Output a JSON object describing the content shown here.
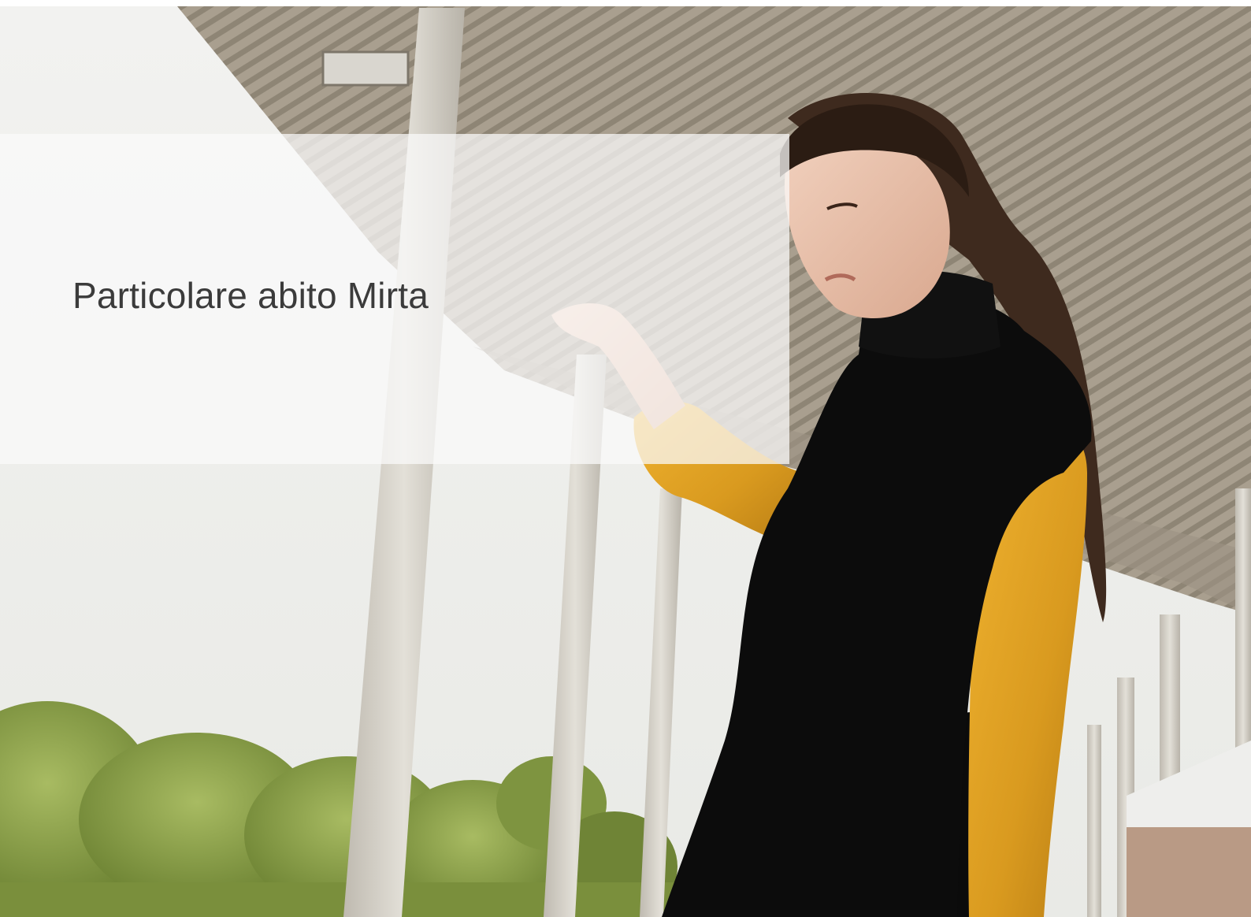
{
  "caption": {
    "text": "Particolare abito Mirta"
  },
  "colors": {
    "background": "#f3f3f1",
    "caption_text": "#3b3b3b",
    "canopy": "#a79e8e",
    "column": "#d6d2c8",
    "dress": "#0d0d0d",
    "sleeve": "#dfa024",
    "foliage": "#8ea44a"
  }
}
